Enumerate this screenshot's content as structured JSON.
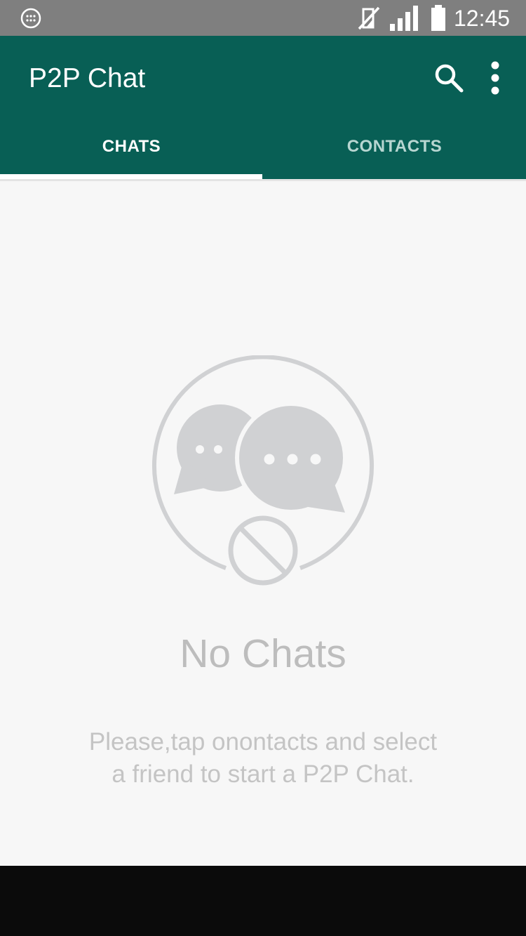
{
  "status_bar": {
    "time": "12:45",
    "icons": [
      "notification-icon",
      "mute-icon",
      "signal-icon",
      "battery-icon"
    ]
  },
  "app_bar": {
    "title": "P2P Chat",
    "actions": [
      "search-icon",
      "more-options-icon"
    ],
    "background_color": "#085f55"
  },
  "tabs": [
    {
      "label": "CHATS",
      "selected": true
    },
    {
      "label": "CONTACTS",
      "selected": false
    }
  ],
  "empty_state": {
    "icon": "no-chats-icon",
    "title": "No Chats",
    "message_lines": [
      "Please,tap onontacts and select",
      "a friend to start a P2P Chat."
    ]
  }
}
